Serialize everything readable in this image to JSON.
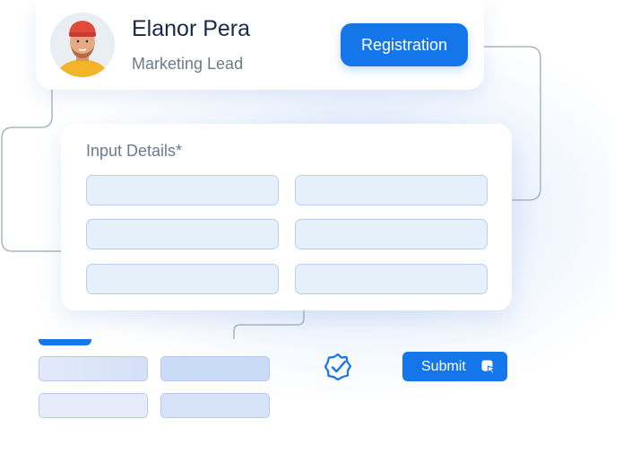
{
  "profile": {
    "name": "Elanor Pera",
    "role": "Marketing Lead",
    "register_label": "Registration"
  },
  "details": {
    "title": "Input Details*",
    "fields": [
      "",
      "",
      "",
      "",
      "",
      ""
    ]
  },
  "actions": {
    "submit_label": "Submit",
    "check_icon": "verified-check-icon",
    "cursor_icon": "cursor-click-icon"
  },
  "colors": {
    "accent": "#1476e8",
    "field_fill": "#e6f0fb",
    "field_border": "#b5d0ef",
    "title_text": "#172a4a",
    "muted_text": "#6b7b8d"
  }
}
